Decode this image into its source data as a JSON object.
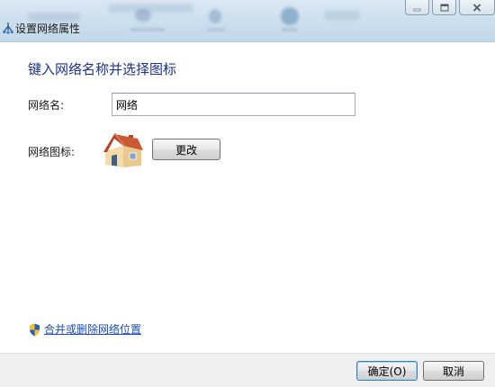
{
  "window": {
    "title": "设置网络属性",
    "title_icon": "network-icon",
    "caption_buttons": [
      "minimize-icon",
      "maximize-icon",
      "close-icon"
    ]
  },
  "main": {
    "heading": "键入网络名称并选择图标",
    "network_name_label": "网络名:",
    "network_name_value": "网络",
    "network_icon_label": "网络图标:",
    "network_icon": "house-icon",
    "change_button_label": "更改",
    "merge_link_label": "合并或删除网络位置",
    "merge_link_icon": "shield-icon"
  },
  "footer": {
    "ok_label": "确定(O)",
    "cancel_label": "取消"
  },
  "colors": {
    "heading": "#1e3287",
    "link": "#1c4fa8",
    "titlebar": "#cfe0ee",
    "footer": "#f0f0f0"
  }
}
